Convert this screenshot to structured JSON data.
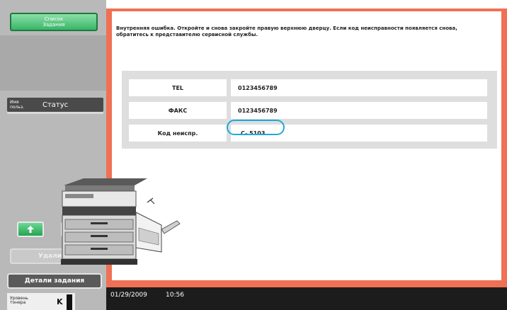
{
  "left_panel": {
    "job_list_button": "Список\nЗадания",
    "tab_user": "Имя\nпольз.",
    "tab_status": "Статус",
    "delete_button": "Удалить",
    "job_details_button": "Детали задания",
    "toner_label": "Уровень\nтонера",
    "toner_color": "K"
  },
  "message": {
    "text": "Внутренняя ошибка. Откройте и снова закройте правую верхнюю дверцу. Если код неисправности появляется снова, обратитесь к представителю сервисной службы."
  },
  "info_table": {
    "rows": [
      {
        "label": "TEL",
        "value": "0123456789"
      },
      {
        "label": "ФАКС",
        "value": "0123456789"
      },
      {
        "label": "Код неиспр.",
        "value": "C- 5103"
      }
    ]
  },
  "status_bar": {
    "date": "01/29/2009",
    "time": "10:56"
  },
  "colors": {
    "frame_accent": "#f07054",
    "highlight": "#22a8d8",
    "button_green": "#39b566"
  },
  "icons": {
    "scroll_up": "arrow-up-icon",
    "scroll_down": "arrow-down-icon",
    "device": "copier-illustration"
  }
}
